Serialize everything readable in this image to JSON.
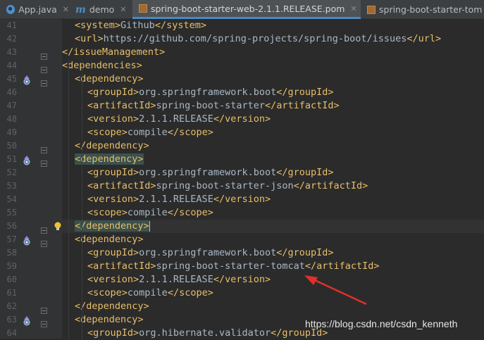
{
  "tabs": [
    {
      "label": "App.java",
      "icon": "java-class-icon",
      "closable": true,
      "active": false
    },
    {
      "label": "demo",
      "icon": "maven-module-icon",
      "closable": true,
      "active": false
    },
    {
      "label": "spring-boot-starter-web-2.1.1.RELEASE.pom",
      "icon": "pom-file-icon",
      "closable": true,
      "active": true
    },
    {
      "label": "spring-boot-starter-tom",
      "icon": "pom-file-icon",
      "closable": false,
      "active": false
    }
  ],
  "lines": [
    {
      "num": "41",
      "indent": 1,
      "parts": [
        [
          "tag",
          "<system>"
        ],
        [
          "txt",
          "Github"
        ],
        [
          "tag",
          "</system>"
        ]
      ]
    },
    {
      "num": "42",
      "indent": 1,
      "parts": [
        [
          "tag",
          "<url>"
        ],
        [
          "txt",
          "https://github.com/spring-projects/spring-boot/issues"
        ],
        [
          "tag",
          "</url>"
        ]
      ]
    },
    {
      "num": "43",
      "indent": 0,
      "parts": [
        [
          "tag",
          "</issueManagement>"
        ]
      ]
    },
    {
      "num": "44",
      "indent": 0,
      "parts": [
        [
          "tag",
          "<dependencies>"
        ]
      ]
    },
    {
      "num": "45",
      "indent": 1,
      "parts": [
        [
          "tag",
          "<dependency>"
        ]
      ]
    },
    {
      "num": "46",
      "indent": 2,
      "parts": [
        [
          "tag",
          "<groupId>"
        ],
        [
          "txt",
          "org.springframework.boot"
        ],
        [
          "tag",
          "</groupId>"
        ]
      ]
    },
    {
      "num": "47",
      "indent": 2,
      "parts": [
        [
          "tag",
          "<artifactId>"
        ],
        [
          "txt",
          "spring-boot-starter"
        ],
        [
          "tag",
          "</artifactId>"
        ]
      ]
    },
    {
      "num": "48",
      "indent": 2,
      "parts": [
        [
          "tag",
          "<version>"
        ],
        [
          "txt",
          "2.1.1.RELEASE"
        ],
        [
          "tag",
          "</version>"
        ]
      ]
    },
    {
      "num": "49",
      "indent": 2,
      "parts": [
        [
          "tag",
          "<scope>"
        ],
        [
          "txt",
          "compile"
        ],
        [
          "tag",
          "</scope>"
        ]
      ]
    },
    {
      "num": "50",
      "indent": 1,
      "parts": [
        [
          "tag",
          "</dependency>"
        ]
      ]
    },
    {
      "num": "51",
      "indent": 1,
      "parts": [
        [
          "tag hl",
          "<dependency>"
        ]
      ]
    },
    {
      "num": "52",
      "indent": 2,
      "parts": [
        [
          "tag",
          "<groupId>"
        ],
        [
          "txt",
          "org.springframework.boot"
        ],
        [
          "tag",
          "</groupId>"
        ]
      ]
    },
    {
      "num": "53",
      "indent": 2,
      "parts": [
        [
          "tag",
          "<artifactId>"
        ],
        [
          "txt",
          "spring-boot-starter-json"
        ],
        [
          "tag",
          "</artifactId>"
        ]
      ]
    },
    {
      "num": "54",
      "indent": 2,
      "parts": [
        [
          "tag",
          "<version>"
        ],
        [
          "txt",
          "2.1.1.RELEASE"
        ],
        [
          "tag",
          "</version>"
        ]
      ]
    },
    {
      "num": "55",
      "indent": 2,
      "parts": [
        [
          "tag",
          "<scope>"
        ],
        [
          "txt",
          "compile"
        ],
        [
          "tag",
          "</scope>"
        ]
      ]
    },
    {
      "num": "56",
      "indent": 1,
      "parts": [
        [
          "tag hl",
          "</dependency>"
        ]
      ]
    },
    {
      "num": "57",
      "indent": 1,
      "parts": [
        [
          "tag",
          "<dependency>"
        ]
      ]
    },
    {
      "num": "58",
      "indent": 2,
      "parts": [
        [
          "tag",
          "<groupId>"
        ],
        [
          "txt",
          "org.springframework.boot"
        ],
        [
          "tag",
          "</groupId>"
        ]
      ]
    },
    {
      "num": "59",
      "indent": 2,
      "parts": [
        [
          "tag",
          "<artifactId>"
        ],
        [
          "txt",
          "spring-boot-starter-tomcat"
        ],
        [
          "tag",
          "</artifactId>"
        ]
      ]
    },
    {
      "num": "60",
      "indent": 2,
      "parts": [
        [
          "tag",
          "<version>"
        ],
        [
          "txt",
          "2.1.1.RELEASE"
        ],
        [
          "tag",
          "</version>"
        ]
      ]
    },
    {
      "num": "61",
      "indent": 2,
      "parts": [
        [
          "tag",
          "<scope>"
        ],
        [
          "txt",
          "compile"
        ],
        [
          "tag",
          "</scope>"
        ]
      ]
    },
    {
      "num": "62",
      "indent": 1,
      "parts": [
        [
          "tag",
          "</dependency>"
        ]
      ]
    },
    {
      "num": "63",
      "indent": 1,
      "parts": [
        [
          "tag",
          "<dependency>"
        ]
      ]
    },
    {
      "num": "64",
      "indent": 2,
      "parts": [
        [
          "tag",
          "<groupId>"
        ],
        [
          "txt",
          "org.hibernate.validator"
        ],
        [
          "tag",
          "</groupId>"
        ]
      ]
    }
  ],
  "gutter_markers": {
    "overrides": [
      "45",
      "51",
      "57",
      "63"
    ],
    "bulb": "56",
    "folds": [
      "43",
      "44",
      "45",
      "50",
      "51",
      "56",
      "57",
      "62",
      "63"
    ]
  },
  "watermark": "https://blog.csdn.net/csdn_kenneth",
  "colors": {
    "tag": "#e8bf6a",
    "text": "#a9b7c6",
    "annotation": "#e0302a",
    "brace_match": "#3b514d"
  }
}
